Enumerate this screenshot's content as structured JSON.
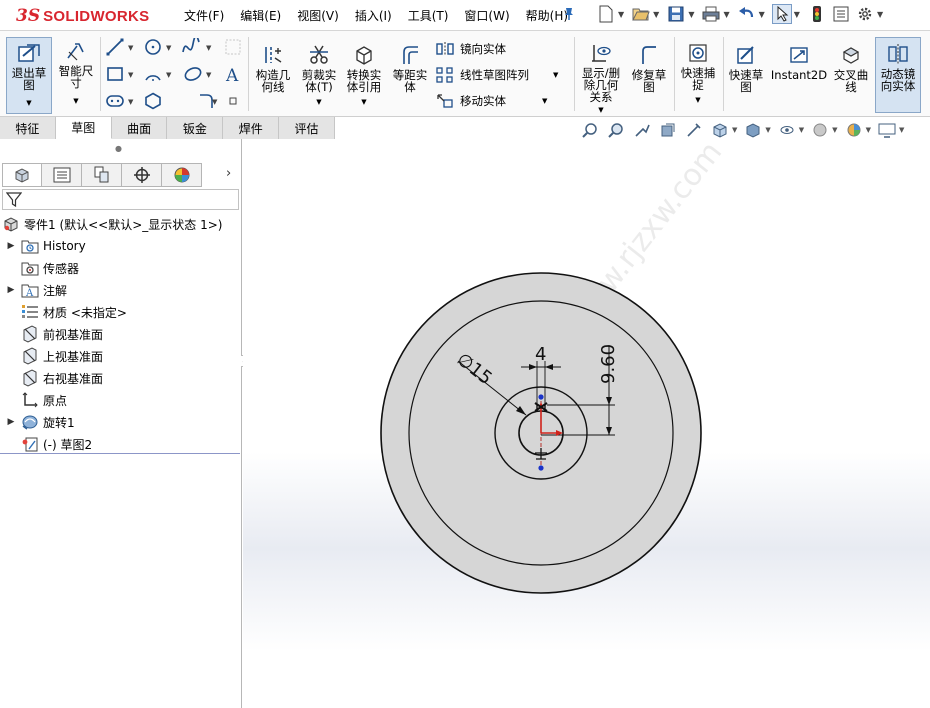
{
  "app": {
    "brand_ds": "3S",
    "brand_name": "SOLIDWORKS"
  },
  "menu": [
    {
      "label": "文件(F)"
    },
    {
      "label": "编辑(E)"
    },
    {
      "label": "视图(V)"
    },
    {
      "label": "插入(I)"
    },
    {
      "label": "工具(T)"
    },
    {
      "label": "窗口(W)"
    },
    {
      "label": "帮助(H)"
    }
  ],
  "ribbon": {
    "exit_sketch": "退出草图",
    "smart_dim": "智能尺寸",
    "construct_geometry": "构造几何线",
    "trim_entities": "剪裁实体(T)",
    "convert_entities": "转换实体引用",
    "offset_entities": "等距实体",
    "mirror_entities": "镜向实体",
    "linear_pattern": "线性草图阵列",
    "move_entities": "移动实体",
    "display_delete_relations": "显示/删除几何关系",
    "repair_sketch": "修复草图",
    "quick_snaps": "快速捕捉",
    "rapid_sketch": "快速草图",
    "instant2d": "Instant2D",
    "intersection_curve": "交叉曲线",
    "dynamic_mirror": "动态镜向实体"
  },
  "tabs": [
    {
      "label": "特征"
    },
    {
      "label": "草图"
    },
    {
      "label": "曲面"
    },
    {
      "label": "钣金"
    },
    {
      "label": "焊件"
    },
    {
      "label": "评估"
    }
  ],
  "active_tab": "草图",
  "tree": {
    "root": "零件1 (默认<<默认>_显示状态 1>)",
    "items": [
      {
        "label": "History",
        "expandable": true
      },
      {
        "label": "传感器",
        "expandable": false
      },
      {
        "label": "注解",
        "expandable": true
      },
      {
        "label": "材质 <未指定>",
        "expandable": false
      },
      {
        "label": "前视基准面",
        "expandable": false
      },
      {
        "label": "上视基准面",
        "expandable": false
      },
      {
        "label": "右视基准面",
        "expandable": false
      },
      {
        "label": "原点",
        "expandable": false
      },
      {
        "label": "旋转1",
        "expandable": true
      },
      {
        "label": "(-) 草图2",
        "expandable": false
      }
    ]
  },
  "sketch": {
    "dim_diameter": "∅15",
    "dim_width": "4",
    "dim_height": "9.60",
    "watermark": "软件目学网 www.rjzxw.com"
  },
  "colors": {
    "accent_red": "#d8262f",
    "ribbon_icon": "#1f4f8a",
    "part_fill": "#d6d6d6",
    "active_button": "#d5e3f2"
  }
}
